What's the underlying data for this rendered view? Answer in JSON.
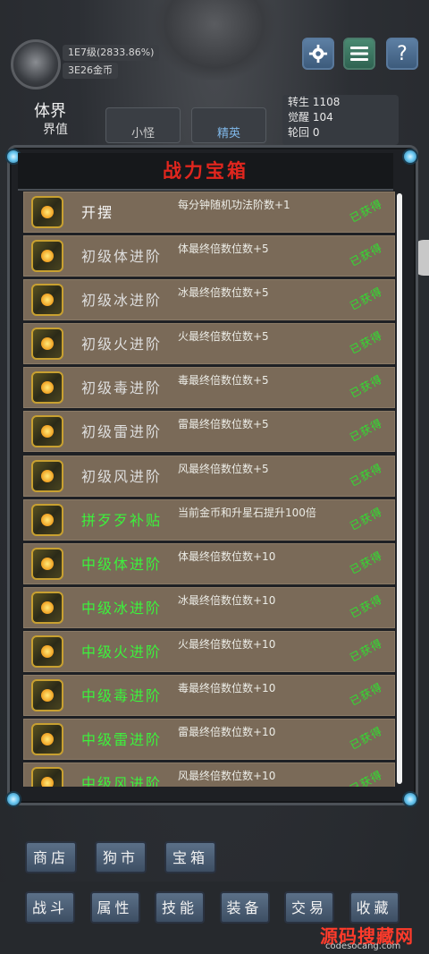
{
  "hud": {
    "level_text": "1E7级(2833.86%)",
    "gold_text": "3E26金币",
    "realm_title": "体界",
    "realm_sub": "界值",
    "tab1_label": "小怪",
    "tab2_label": "精英",
    "info": {
      "rebirth": "转生  1108",
      "awaken": "觉醒  104",
      "cycle": "轮回  0"
    },
    "help_glyph": "?"
  },
  "panel": {
    "title": "战力宝箱",
    "rows": [
      {
        "name": "开摆",
        "desc": "每分钟随机功法阶数+1",
        "status": "已获得",
        "name_color": "white"
      },
      {
        "name": "初级体进阶",
        "desc": "体最终倍数位数+5",
        "status": "已获得",
        "name_color": "gray"
      },
      {
        "name": "初级冰进阶",
        "desc": "冰最终倍数位数+5",
        "status": "已获得",
        "name_color": "gray"
      },
      {
        "name": "初级火进阶",
        "desc": "火最终倍数位数+5",
        "status": "已获得",
        "name_color": "gray"
      },
      {
        "name": "初级毒进阶",
        "desc": "毒最终倍数位数+5",
        "status": "已获得",
        "name_color": "gray"
      },
      {
        "name": "初级雷进阶",
        "desc": "雷最终倍数位数+5",
        "status": "已获得",
        "name_color": "gray"
      },
      {
        "name": "初级风进阶",
        "desc": "风最终倍数位数+5",
        "status": "已获得",
        "name_color": "gray"
      },
      {
        "name": "拼歹歹补贴",
        "desc": "当前金币和升星石提升100倍",
        "status": "已获得",
        "name_color": "green"
      },
      {
        "name": "中级体进阶",
        "desc": "体最终倍数位数+10",
        "status": "已获得",
        "name_color": "green"
      },
      {
        "name": "中级冰进阶",
        "desc": "冰最终倍数位数+10",
        "status": "已获得",
        "name_color": "green"
      },
      {
        "name": "中级火进阶",
        "desc": "火最终倍数位数+10",
        "status": "已获得",
        "name_color": "green"
      },
      {
        "name": "中级毒进阶",
        "desc": "毒最终倍数位数+10",
        "status": "已获得",
        "name_color": "green"
      },
      {
        "name": "中级雷进阶",
        "desc": "雷最终倍数位数+10",
        "status": "已获得",
        "name_color": "green"
      },
      {
        "name": "中级风进阶",
        "desc": "风最终倍数位数+10",
        "status": "已获得",
        "name_color": "green"
      }
    ]
  },
  "menu_row1": [
    "商店",
    "狗市",
    "宝箱"
  ],
  "menu_row2": [
    "战斗",
    "属性",
    "技能",
    "装备",
    "交易",
    "收藏"
  ],
  "watermark": {
    "main": "源码搜藏网",
    "sub": "codesocang.com"
  },
  "colors": {
    "title_red": "#e0261e",
    "name_green": "#3cf23c",
    "status_green": "#30e030",
    "row_brown": "#7a6a58"
  },
  "icons": [
    "gear-icon",
    "list-menu-icon",
    "help-icon",
    "treasure-chest-icon"
  ]
}
